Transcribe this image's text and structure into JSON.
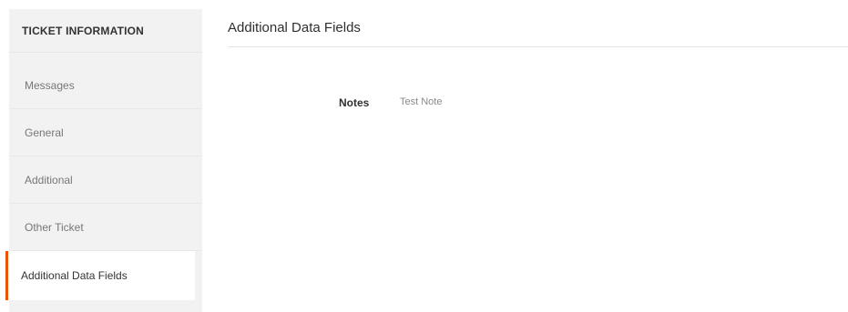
{
  "sidebar": {
    "title": "TICKET INFORMATION",
    "items": [
      {
        "label": "Messages"
      },
      {
        "label": "General"
      },
      {
        "label": "Additional"
      },
      {
        "label": "Other Ticket"
      },
      {
        "label": "Additional Data Fields"
      }
    ],
    "active_index": 4,
    "accent_color": "#eb5202"
  },
  "main": {
    "title": "Additional Data Fields",
    "fields": [
      {
        "label": "Notes",
        "value": "Test Note"
      }
    ]
  }
}
